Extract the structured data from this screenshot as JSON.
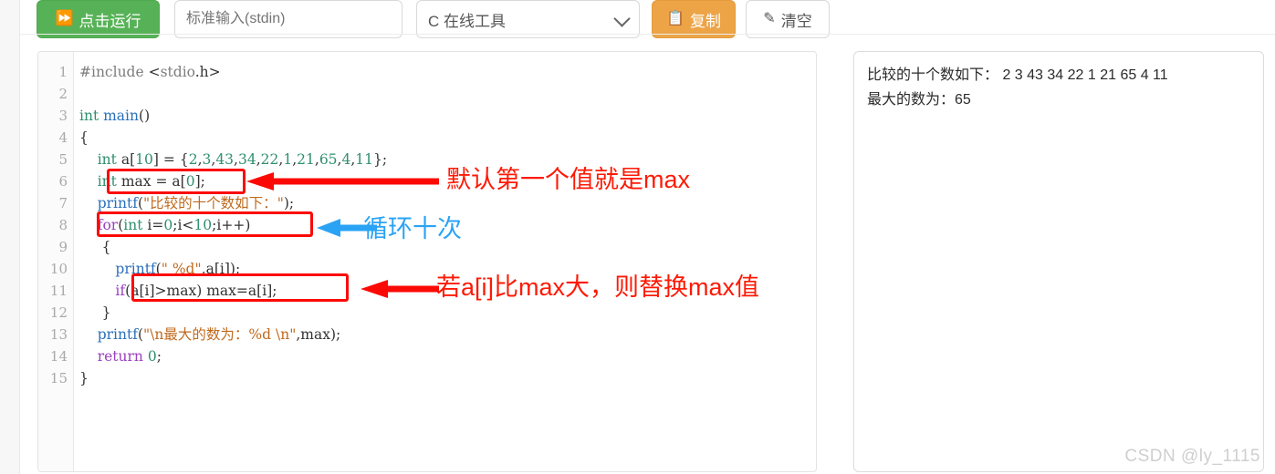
{
  "toolbar": {
    "run_button": {
      "label": "点击运行",
      "icon": "play-run-icon",
      "color": "#57b257"
    },
    "stdin_input": {
      "value": "",
      "placeholder": "标准输入(stdin)"
    },
    "language_select": {
      "value": "C 在线工具",
      "icon": "chevron-down-icon"
    },
    "copy_button": {
      "label": "复制",
      "icon": "copy-icon",
      "color": "#eda447"
    },
    "clear_button": {
      "label": "清空",
      "icon": "eraser-icon",
      "color": "#ffffff"
    }
  },
  "editor": {
    "line_numbers": [
      "1",
      "2",
      "3",
      "4",
      "5",
      "6",
      "7",
      "8",
      "9",
      "10",
      "11",
      "12",
      "13",
      "14",
      "15"
    ],
    "lines": [
      {
        "n": "1",
        "text": "#include <stdio.h>"
      },
      {
        "n": "2",
        "text": ""
      },
      {
        "n": "3",
        "text": "int main()"
      },
      {
        "n": "4",
        "text": "{"
      },
      {
        "n": "5",
        "text": "    int a[10] = {2,3,43,34,22,1,21,65,4,11};"
      },
      {
        "n": "6",
        "text": "    int max = a[0];"
      },
      {
        "n": "7",
        "text": "    printf(\"比较的十个数如下：\");"
      },
      {
        "n": "8",
        "text": "    for(int i=0;i<10;i++)"
      },
      {
        "n": "9",
        "text": "     {"
      },
      {
        "n": "10",
        "text": "        printf(\" %d\",a[i]);"
      },
      {
        "n": "11",
        "text": "        if(a[i]>max) max=a[i];"
      },
      {
        "n": "12",
        "text": "     }"
      },
      {
        "n": "13",
        "text": "    printf(\"\\n最大的数为：%d \\n\",max);"
      },
      {
        "n": "14",
        "text": "    return 0;"
      },
      {
        "n": "15",
        "text": "}"
      }
    ]
  },
  "output": {
    "lines": [
      "比较的十个数如下： 2 3 43 34 22 1 21 65 4 11",
      "最大的数为：65"
    ],
    "numbers": [
      2,
      3,
      43,
      34,
      22,
      1,
      21,
      65,
      4,
      11
    ],
    "max_value": 65
  },
  "annotations": [
    {
      "id": "a1",
      "text": "默认第一个值就是max",
      "color": "#fd1a06",
      "target_line": 6
    },
    {
      "id": "a2",
      "text": "循环十次",
      "color": "#2aa3f5",
      "target_line": 8
    },
    {
      "id": "a3",
      "text": "若a[i]比max大，则替换max值",
      "color": "#fd1a06",
      "target_line": 11
    }
  ],
  "watermark": {
    "text": "CSDN @ly_1115"
  }
}
